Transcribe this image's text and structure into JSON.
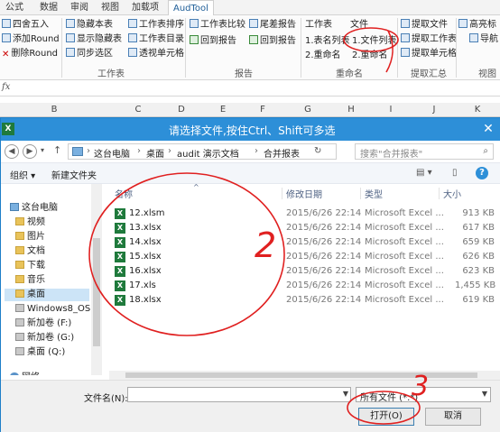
{
  "ribbon": {
    "tabs": [
      "公式",
      "数据",
      "审阅",
      "视图",
      "加载项",
      "AudTool"
    ],
    "active_tab": "AudTool",
    "items": {
      "round4": "四舍五入",
      "add_round": "添加Round",
      "del_round": "删除Round",
      "hide_sheet": "隐藏本表",
      "show_hidden": "显示隐藏表",
      "sync_select": "同步选区",
      "sheet_sort": "工作表排序",
      "sheet_dir": "工作表目录",
      "pivot_cell": "透视单元格",
      "sheet_compare": "工作表比较",
      "back_report": "回到报告",
      "tail_report": "尾差报告",
      "back_report2": "回到报告",
      "sheet_label": "工作表",
      "table_list": "1.表名列表",
      "rename1": "2.重命名",
      "file_label": "文件",
      "file_list": "1.文件列表",
      "rename2": "2.重命名",
      "extract_file": "提取文件",
      "extract_sheet": "提取工作表",
      "extract_cell": "提取单元格",
      "high_light": "高亮标",
      "nav": "导航"
    },
    "groups": {
      "g1": "工作表",
      "g2": "报告",
      "g3": "重命名",
      "g4": "提取汇总",
      "g5": "视图"
    }
  },
  "formula_bar": {
    "fx": "fx"
  },
  "columns": [
    "B",
    "C",
    "D",
    "E",
    "F",
    "G",
    "H",
    "I",
    "J",
    "K"
  ],
  "dialog": {
    "title": "请选择文件,按住Ctrl、Shift可多选",
    "close": "✕",
    "breadcrumbs": [
      "这台电脑",
      "桌面",
      "audit 演示文档",
      "合并报表"
    ],
    "search_placeholder": "搜索\"合并报表\"",
    "toolbar": {
      "organize": "组织 ▾",
      "new_folder": "新建文件夹"
    },
    "tree": {
      "this_pc": "这台电脑",
      "videos": "视频",
      "pictures": "图片",
      "documents": "文档",
      "downloads": "下载",
      "music": "音乐",
      "desktop": "桌面",
      "win8": "Windows8_OS (C",
      "vol_f": "新加卷 (F:)",
      "vol_g": "新加卷 (G:)",
      "desk_q": "桌面 (Q:)",
      "network": "网络"
    },
    "columns": {
      "name": "名称",
      "date": "修改日期",
      "type": "类型",
      "size": "大小"
    },
    "files": [
      {
        "name": "12.xlsm",
        "date": "2015/6/26 22:14",
        "type": "Microsoft Excel ...",
        "size": "913 KB"
      },
      {
        "name": "13.xlsx",
        "date": "2015/6/26 22:14",
        "type": "Microsoft Excel ...",
        "size": "617 KB"
      },
      {
        "name": "14.xlsx",
        "date": "2015/6/26 22:14",
        "type": "Microsoft Excel ...",
        "size": "659 KB"
      },
      {
        "name": "15.xlsx",
        "date": "2015/6/26 22:14",
        "type": "Microsoft Excel ...",
        "size": "626 KB"
      },
      {
        "name": "16.xlsx",
        "date": "2015/6/26 22:14",
        "type": "Microsoft Excel ...",
        "size": "623 KB"
      },
      {
        "name": "17.xls",
        "date": "2015/6/26 22:14",
        "type": "Microsoft Excel ...",
        "size": "1,455 KB"
      },
      {
        "name": "18.xlsx",
        "date": "2015/6/26 22:14",
        "type": "Microsoft Excel ...",
        "size": "619 KB"
      }
    ],
    "filename_label": "文件名(N):",
    "filename_value": "",
    "filetype_value": "所有文件 (*.*)",
    "open_label": "打开(O)",
    "cancel_label": "取消"
  },
  "annotations": {
    "mark1": "1",
    "mark2": "2",
    "mark3": "3"
  },
  "colors": {
    "title_bar": "#2d8fd8",
    "accent": "#1f5e98",
    "annotation": "#e02020"
  }
}
